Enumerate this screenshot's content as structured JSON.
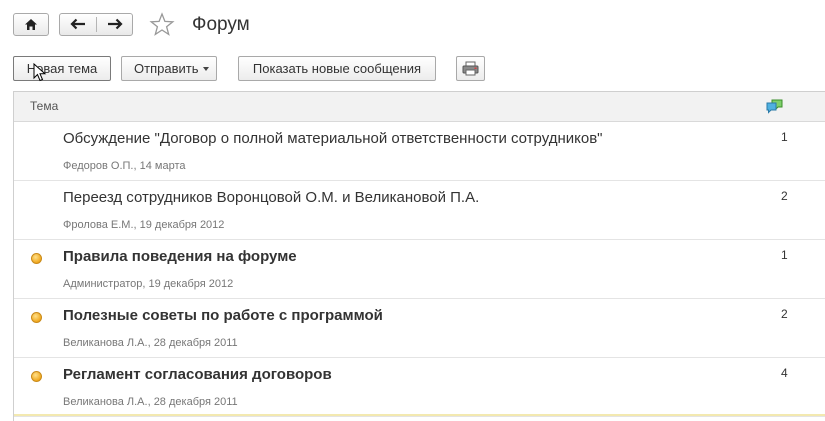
{
  "header": {
    "title": "Форум",
    "icons": {
      "home": "home-icon",
      "back": "arrow-left-icon",
      "forward": "arrow-right-icon",
      "favorite": "star-icon"
    }
  },
  "toolbar": {
    "new_topic": "Новая тема",
    "send": "Отправить",
    "show_new": "Показать новые сообщения",
    "print_icon": "printer-icon"
  },
  "table": {
    "columns": {
      "topic": "Тема",
      "count_icon": "messages-icon"
    },
    "rows": [
      {
        "topic": "Обсуждение \"Договор о полной материальной ответственности сотрудников\"",
        "meta": "Федоров О.П., 14 марта",
        "count": "1",
        "unread": false
      },
      {
        "topic": "Переезд сотрудников Воронцовой О.М. и Великановой П.А.",
        "meta": "Фролова Е.М., 19 декабря 2012",
        "count": "2",
        "unread": false
      },
      {
        "topic": "Правила поведения на форуме",
        "meta": "Администратор, 19 декабря 2012",
        "count": "1",
        "unread": true
      },
      {
        "topic": "Полезные советы по работе с программой",
        "meta": "Великанова Л.А., 28 декабря 2011",
        "count": "2",
        "unread": true
      },
      {
        "topic": "Регламент согласования договоров",
        "meta": "Великанова Л.А., 28 декабря 2011",
        "count": "4",
        "unread": true
      }
    ]
  },
  "colors": {
    "unread_dot": "#f0a81e",
    "messages_icon": "#3a9f3a"
  }
}
